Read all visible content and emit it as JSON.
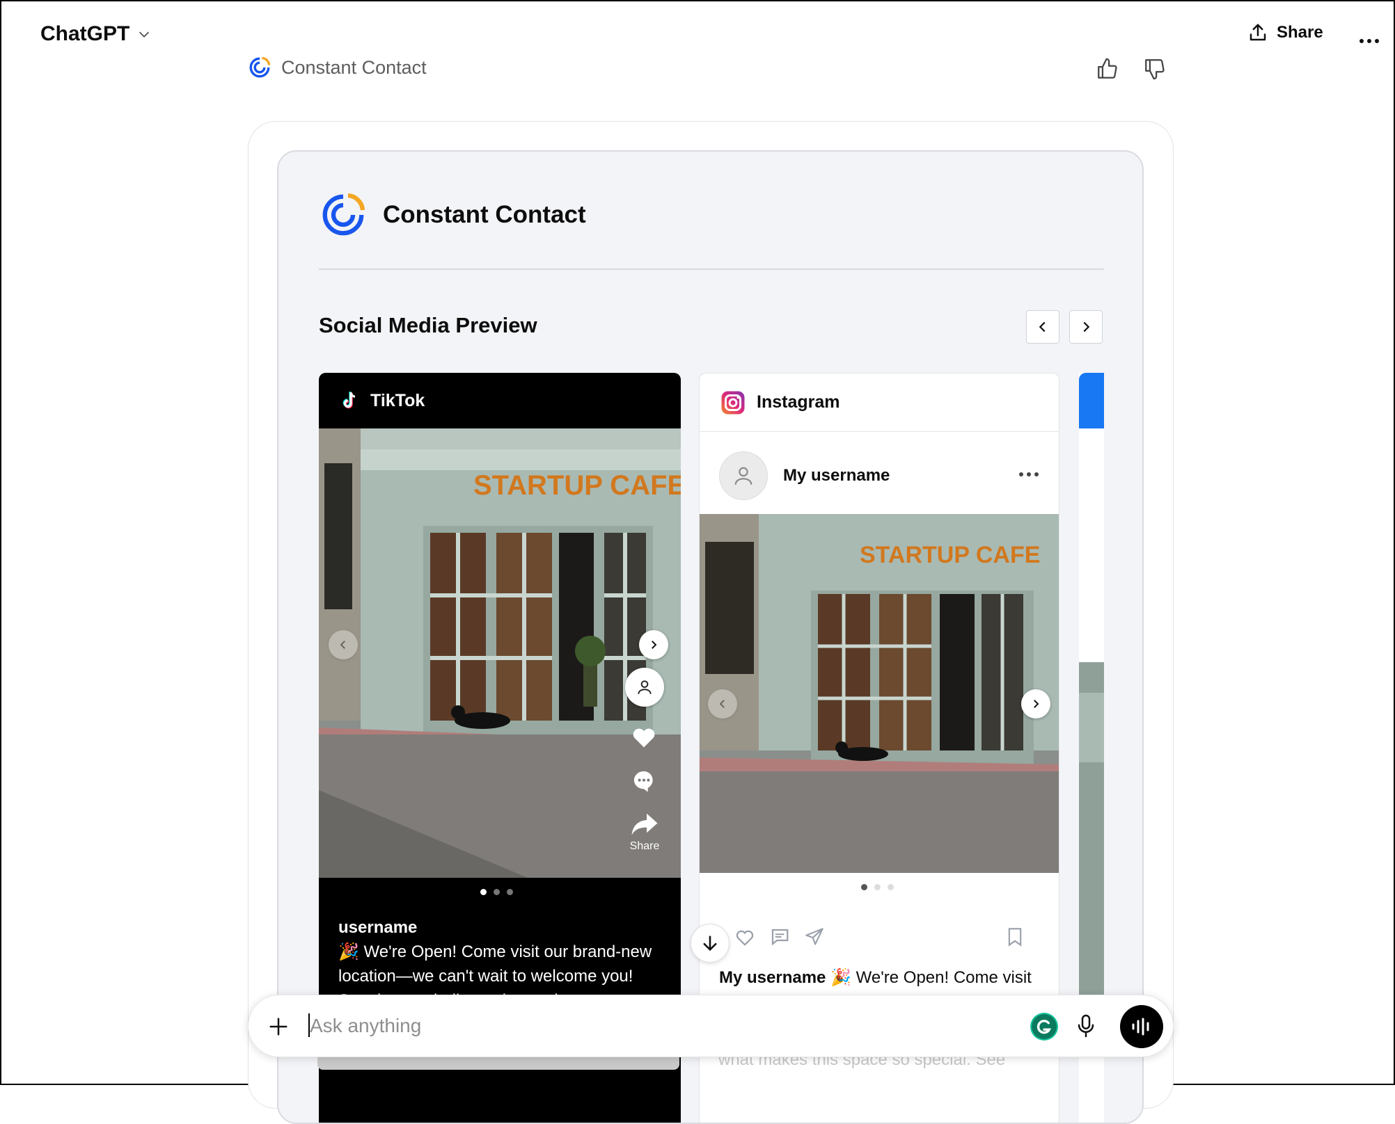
{
  "header": {
    "app_title": "ChatGPT",
    "share_label": "Share",
    "more_label": "···"
  },
  "app_row": {
    "name": "Constant Contact"
  },
  "widget": {
    "brand_title": "Constant Contact",
    "section_title": "Social Media Preview",
    "tiktok": {
      "platform": "TikTok",
      "share_label": "Share",
      "username": "username",
      "caption": "🎉 We're Open! Come visit our brand-new location—we can't wait to welcome you! Stop by, say hello, and see what"
    },
    "instagram": {
      "platform": "Instagram",
      "username": "My username",
      "caption_user": "My username",
      "caption": "🎉 We're Open! Come visit",
      "faded_text": "what makes this space so special. See"
    },
    "sign_text": "STARTUP CAFE"
  },
  "composer": {
    "placeholder": "Ask anything"
  },
  "colors": {
    "cc_blue": "#1856ED",
    "cc_orange": "#F5A623",
    "tiktok_bg": "#000000",
    "panel_bg": "#F3F4F7"
  }
}
